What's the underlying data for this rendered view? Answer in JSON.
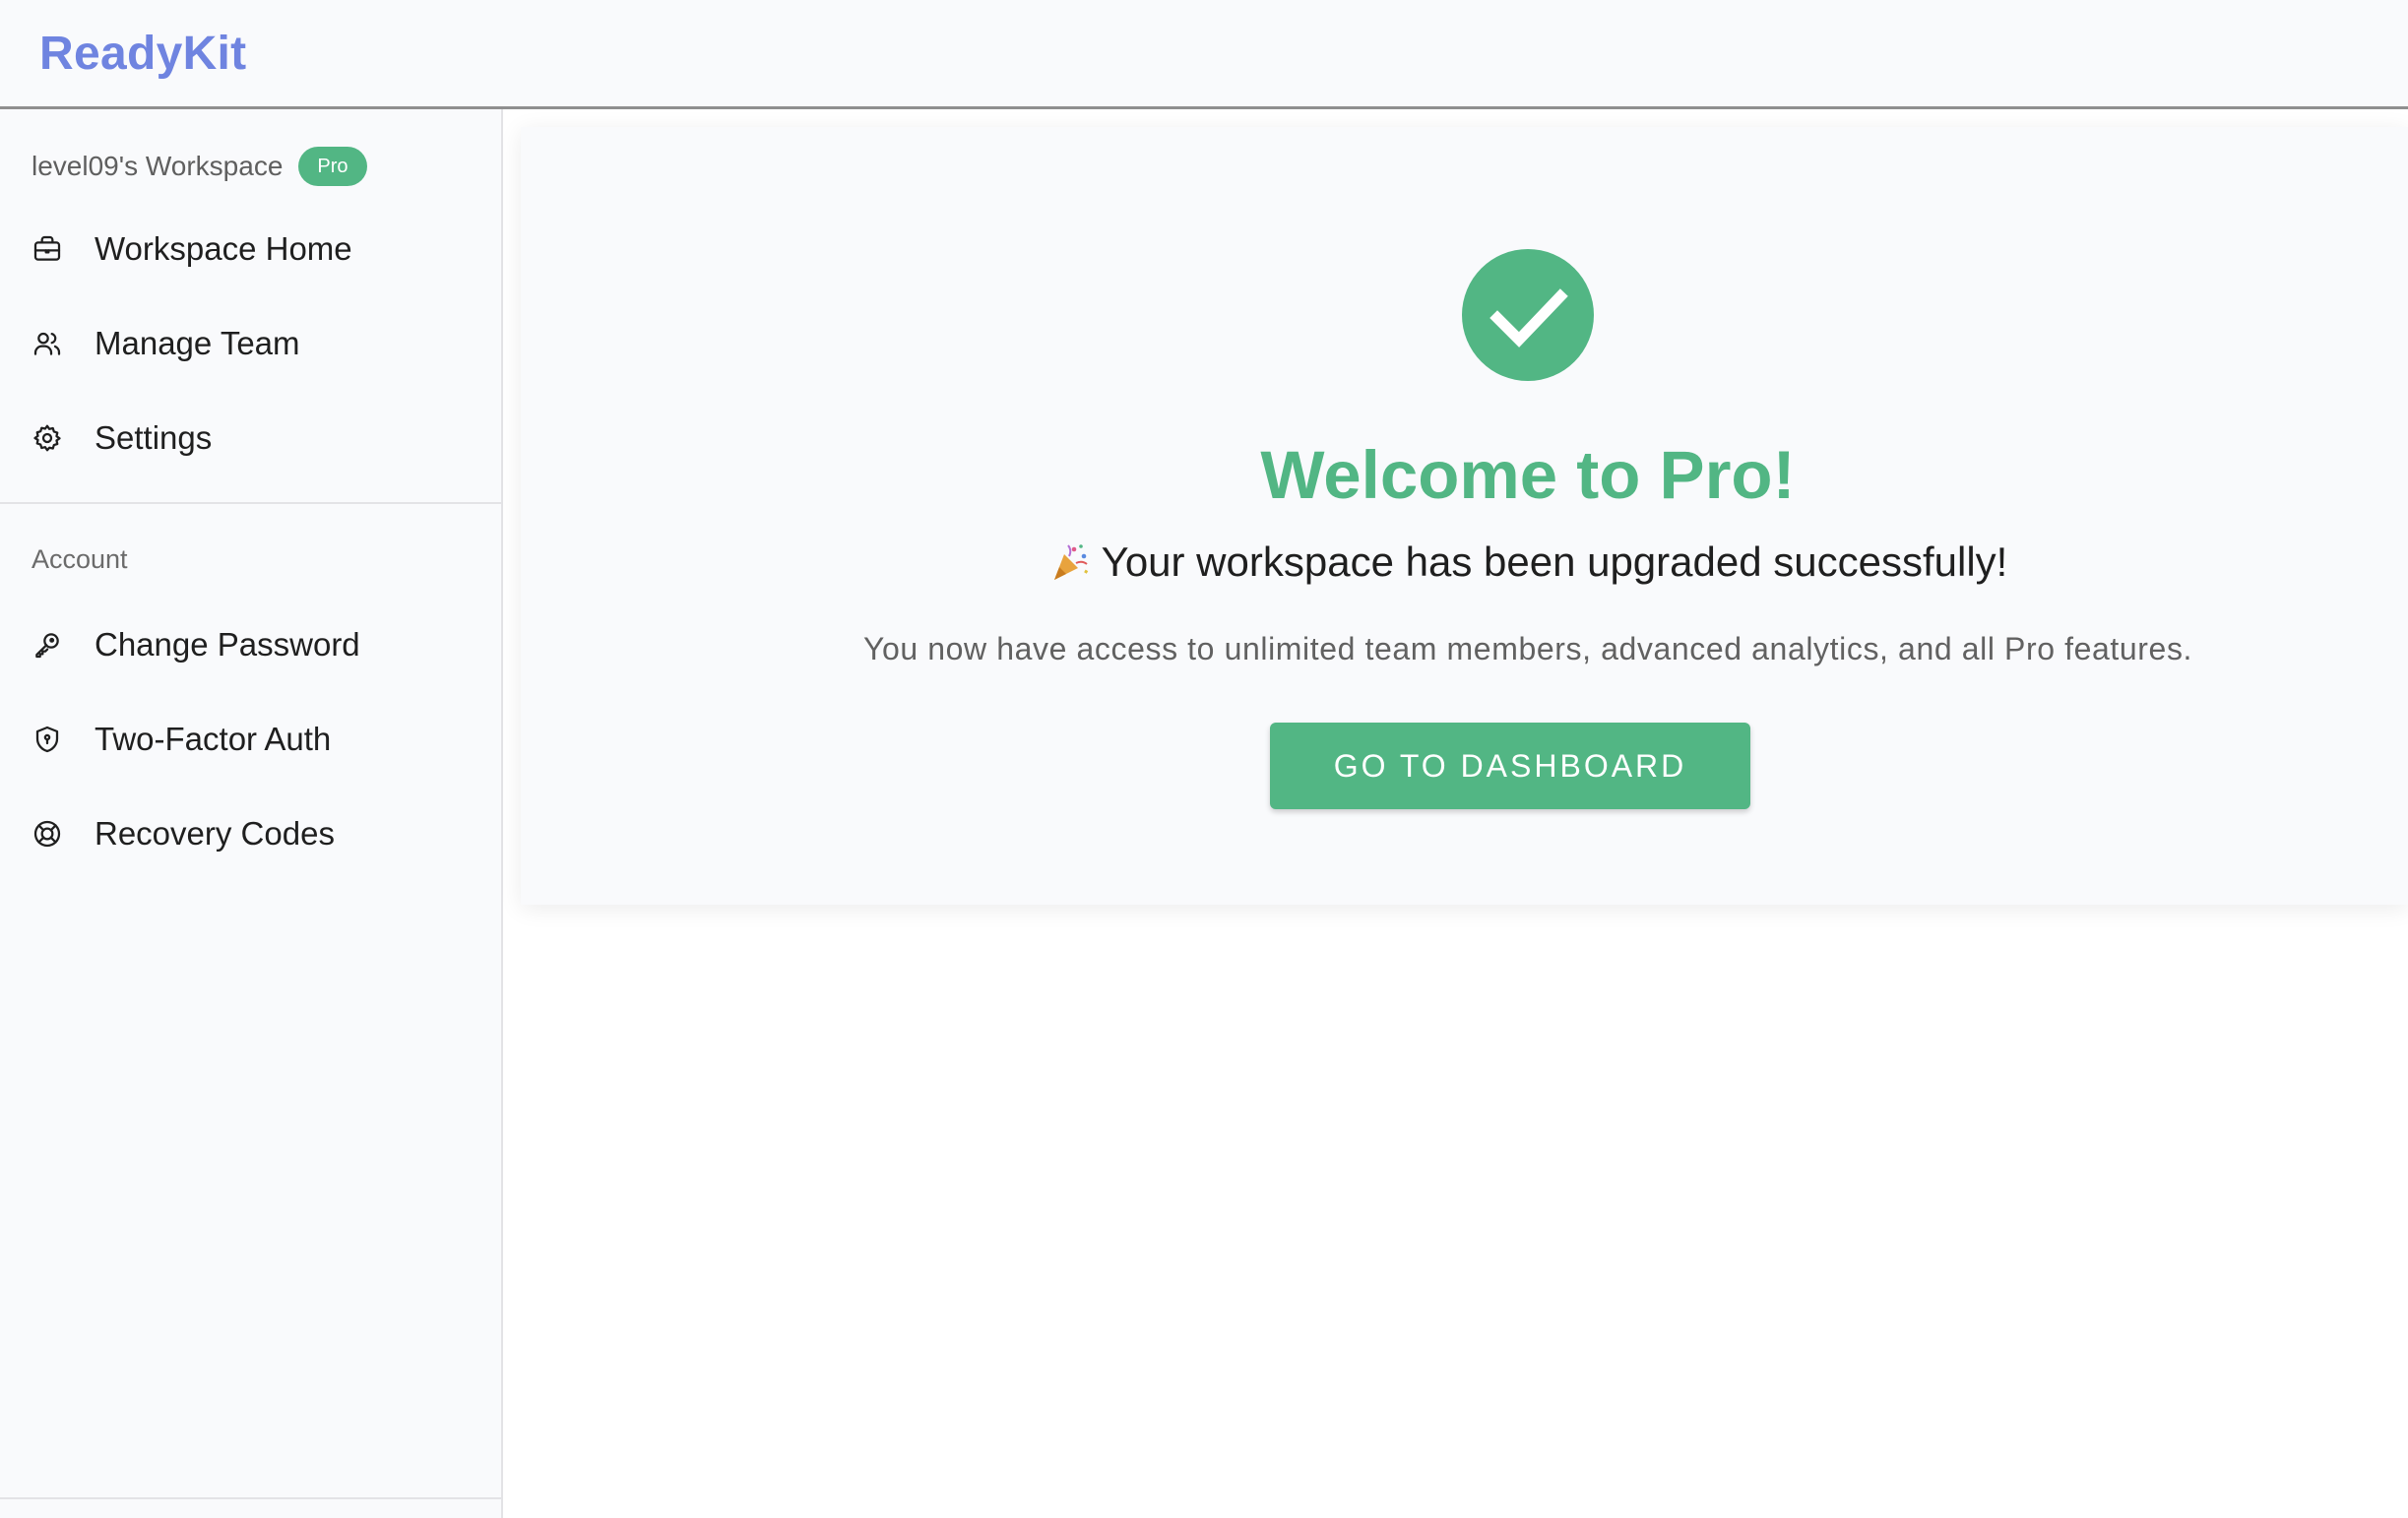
{
  "app": {
    "brand": "ReadyKit"
  },
  "sidebar": {
    "workspace_name": "level09's Workspace",
    "plan_badge": "Pro",
    "items": [
      {
        "label": "Workspace Home",
        "icon": "briefcase-icon"
      },
      {
        "label": "Manage Team",
        "icon": "users-icon"
      },
      {
        "label": "Settings",
        "icon": "gear-icon"
      }
    ],
    "account_section_label": "Account",
    "account_items": [
      {
        "label": "Change Password",
        "icon": "key-icon"
      },
      {
        "label": "Two-Factor Auth",
        "icon": "shield-icon"
      },
      {
        "label": "Recovery Codes",
        "icon": "lifebuoy-icon"
      }
    ]
  },
  "main": {
    "success_icon": "check-circle-icon",
    "title": "Welcome to Pro!",
    "subtitle_icon": "party-popper-icon",
    "subtitle": "Your workspace has been upgraded successfully!",
    "description": "You now have access to unlimited team members, advanced analytics, and all Pro features.",
    "cta_label": "GO TO DASHBOARD"
  },
  "colors": {
    "brand": "#6f84e0",
    "accent_green": "#52b684",
    "panel_bg": "#f9fafc"
  }
}
